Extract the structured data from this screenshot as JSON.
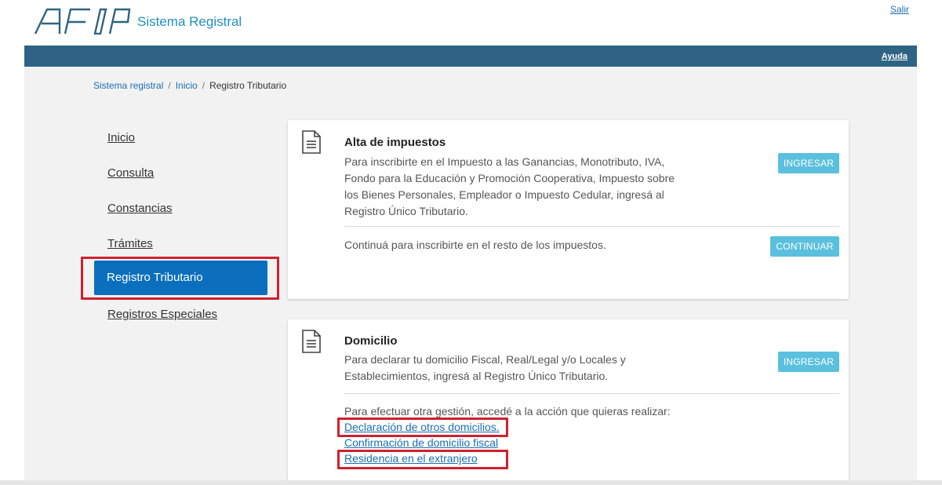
{
  "header": {
    "app_title": "Sistema Registral",
    "salir_label": "Salir",
    "logo_name": "AFIP"
  },
  "top_bar": {
    "ayuda_label": "Ayuda",
    "color": "#2f6383"
  },
  "breadcrumb": {
    "items": [
      "Sistema registral",
      "Inicio",
      "Registro Tributario"
    ],
    "separator": "/"
  },
  "sidebar": {
    "items": [
      {
        "label": "Inicio",
        "active": false
      },
      {
        "label": "Consulta",
        "active": false
      },
      {
        "label": "Constancias",
        "active": false
      },
      {
        "label": "Trámites",
        "active": false
      },
      {
        "label": "Registro Tributario",
        "active": true
      },
      {
        "label": "Registros Especiales",
        "active": false
      }
    ]
  },
  "cards": [
    {
      "title": "Alta de impuestos",
      "text": "Para inscribirte en el Impuesto a las Ganancias, Monotributo, IVA, Fondo para la Educación y Promoción Cooperativa, Impuesto sobre los Bienes Personales, Empleador o Impuesto Cedular, ingresá al Registro Único Tributario.",
      "button_label": "INGRESAR",
      "secondary_text": "Continuá para inscribirte en el resto de los impuestos.",
      "secondary_button_label": "CONTINUAR"
    },
    {
      "title": "Domicilio",
      "text": "Para declarar tu domicilio Fiscal, Real/Legal y/o Locales y Establecimientos, ingresá al Registro Único Tributario.",
      "button_label": "INGRESAR",
      "secondary_text": "Para efectuar otra gestión, accedé a la acción que quieras realizar:",
      "links": [
        "Declaración de otros domicilios.",
        "Confirmación de domicilio fiscal",
        "Residencia en el extranjero"
      ]
    }
  ],
  "colors": {
    "accent": "#1f8fc0",
    "active_nav": "#0b6fbd",
    "button": "#5bc0de",
    "highlight": "#d0202e",
    "link": "#1a6fb0"
  }
}
